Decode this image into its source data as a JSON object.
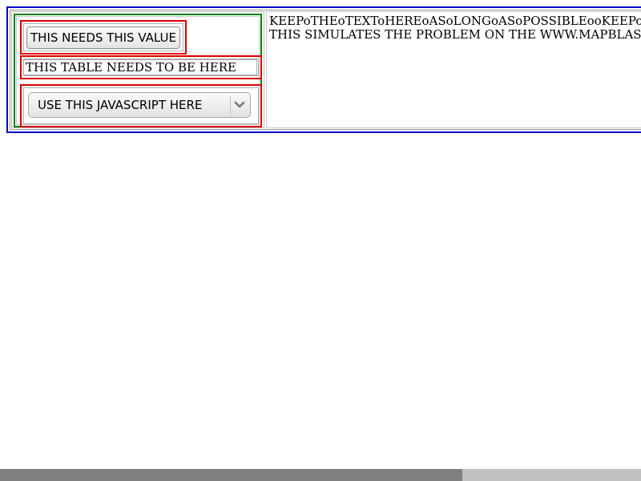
{
  "left_panel": {
    "button_label": "THIS NEEDS THIS VALUE",
    "table_text": "THIS TABLE NEEDS TO BE HERE",
    "select_value": "USE THIS JAVASCRIPT HERE"
  },
  "right_panel": {
    "line1": "KEEPoTHEoTEXToHEREoASoLONGoASoPOSSIBLEooKEEPoTHEoTEXToHEREoASoLONGoASoPOSSIBLE",
    "line2": "THIS SIMULATES THE PROBLEM ON THE WWW.MAPBLAST.COM"
  },
  "colors": {
    "outer_border": "#0000cc",
    "green_border": "#008000",
    "red_border": "#dd0000"
  },
  "icons": {
    "select_arrow": "chevron-down-icon"
  }
}
